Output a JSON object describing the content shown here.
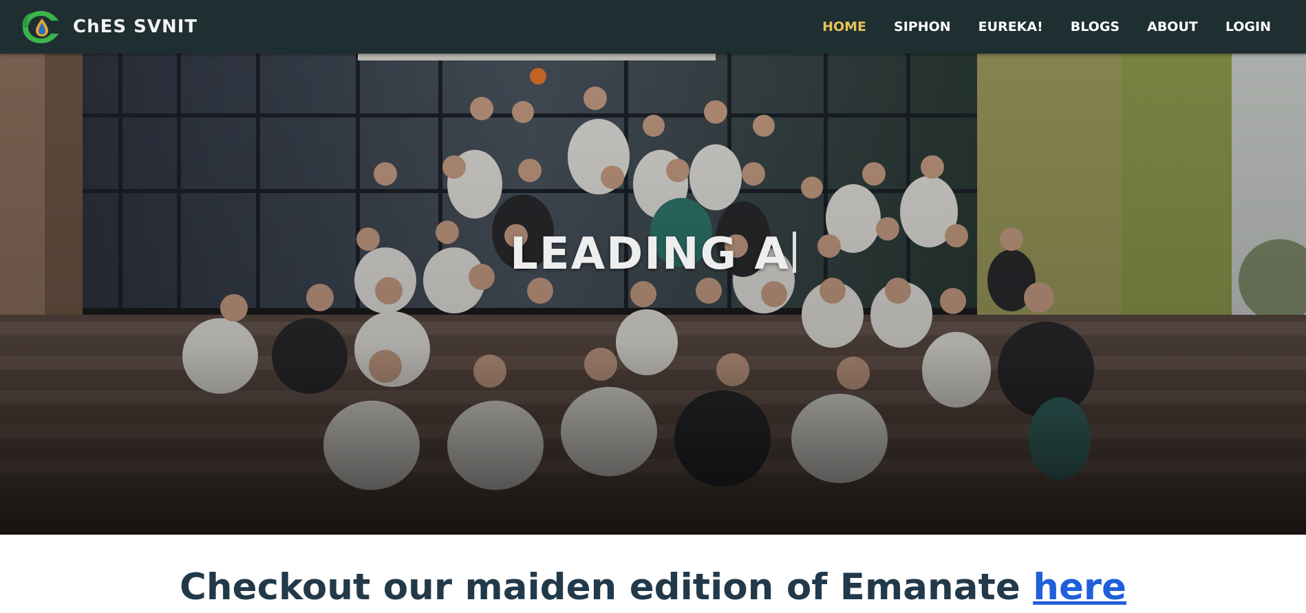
{
  "brand": {
    "name": "ChES SVNIT",
    "logo_icon": "drop-leaf-logo-icon"
  },
  "nav": {
    "items": [
      {
        "label": "HOME",
        "active": true
      },
      {
        "label": "SIPHON",
        "active": false
      },
      {
        "label": "EUREKA!",
        "active": false
      },
      {
        "label": "BLOGS",
        "active": false
      },
      {
        "label": "ABOUT",
        "active": false
      },
      {
        "label": "LOGIN",
        "active": false
      }
    ]
  },
  "hero": {
    "typed_text": "LEADING A",
    "image": "group-photo-on-steps"
  },
  "announcement": {
    "text": "Checkout our maiden edition of Emanate ",
    "link_label": "here"
  },
  "colors": {
    "navbar_bg": "#1f2f31",
    "nav_active": "#e8c25a",
    "nav_text": "#ffffff",
    "announce_text": "#22394a",
    "link": "#1f5fd9"
  }
}
